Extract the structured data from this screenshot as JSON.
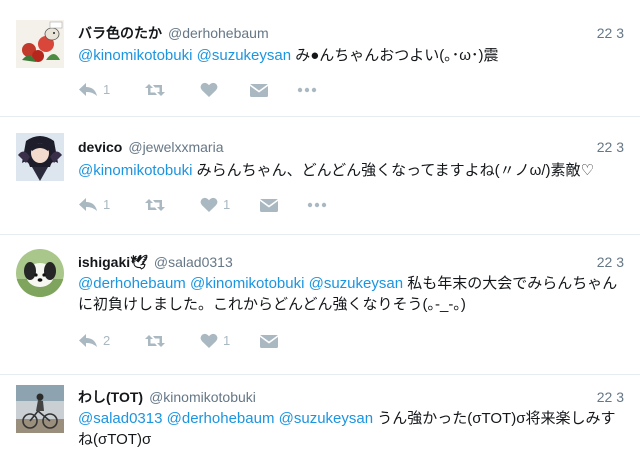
{
  "tweets": [
    {
      "name": "バラ色のたか",
      "handle": "@derhohebaum",
      "time": "22 3",
      "avatar": "bird-with-flowers-avatar",
      "body": [
        {
          "type": "mention",
          "text": "@kinomikotobuki"
        },
        {
          "type": "text",
          "text": " "
        },
        {
          "type": "mention",
          "text": "@suzukeysan"
        },
        {
          "type": "text",
          "text": " み●んちゃんおつよい(｡･ω･)震"
        }
      ],
      "actions": {
        "reply": "1",
        "retweet": "",
        "like": "",
        "dm": "",
        "more": ""
      }
    },
    {
      "name": "devico",
      "handle": "@jewelxxmaria",
      "time": "22 3",
      "avatar": "anime-character-avatar",
      "body": [
        {
          "type": "mention",
          "text": "@kinomikotobuki"
        },
        {
          "type": "text",
          "text": " みらんちゃん、どんどん強くなってますよね(〃ノω/)素敵♡"
        }
      ],
      "actions": {
        "reply": "1",
        "retweet": "",
        "like": "1",
        "dm": "",
        "more": ""
      }
    },
    {
      "name": "ishigaki🕊",
      "handle": "@salad0313",
      "time": "22 3",
      "avatar": "dog-photo-avatar",
      "body": [
        {
          "type": "mention",
          "text": "@derhohebaum"
        },
        {
          "type": "text",
          "text": " "
        },
        {
          "type": "mention",
          "text": "@kinomikotobuki"
        },
        {
          "type": "text",
          "text": " "
        },
        {
          "type": "mention",
          "text": "@suzukeysan"
        },
        {
          "type": "text",
          "text": " 私も年末の大会でみらんちゃんに初負けしました。これからどんどん強くなりそう(｡-_-｡)"
        }
      ],
      "actions": {
        "reply": "2",
        "retweet": "",
        "like": "1",
        "dm": "",
        "more": ""
      }
    },
    {
      "name": "わし(TOT)",
      "handle": "@kinomikotobuki",
      "time": "22 3",
      "avatar": "cyclist-photo-avatar",
      "body": [
        {
          "type": "mention",
          "text": "@salad0313"
        },
        {
          "type": "text",
          "text": " "
        },
        {
          "type": "mention",
          "text": "@derhohebaum"
        },
        {
          "type": "text",
          "text": " "
        },
        {
          "type": "mention",
          "text": "@suzukeysan"
        },
        {
          "type": "text",
          "text": " うん強かった(σTOT)σ将来楽しみすね(σTOT)σ"
        }
      ],
      "actions": {
        "reply": "",
        "retweet": "",
        "like": "",
        "dm": "",
        "more": ""
      }
    }
  ],
  "colors": {
    "mention": "#1b95e0",
    "muted": "#657786",
    "icon": "#aab8c2",
    "divider": "#e6ecf0"
  }
}
